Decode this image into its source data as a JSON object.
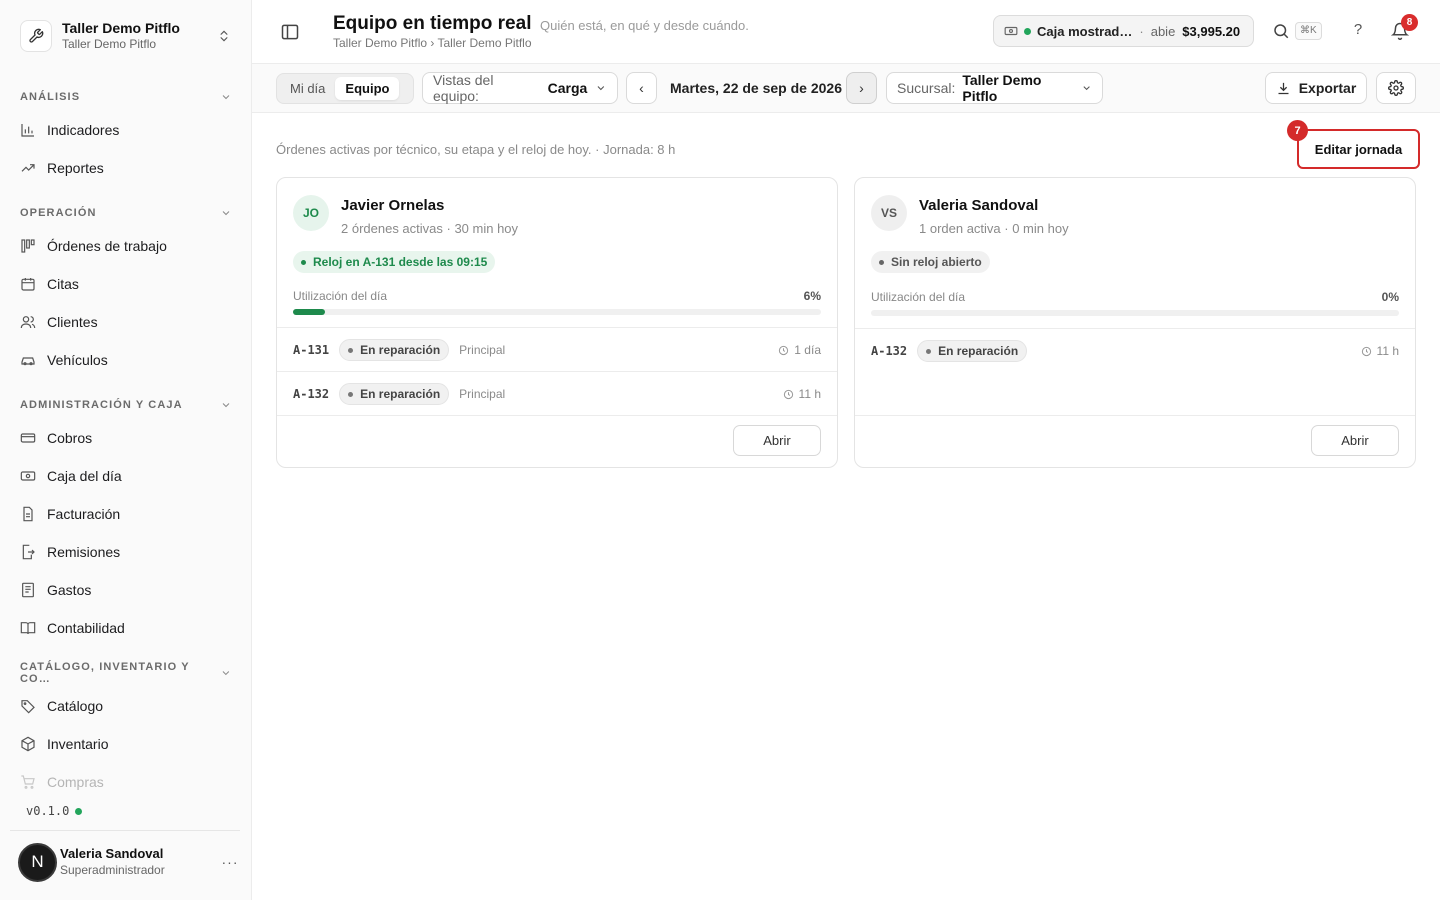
{
  "workspace": {
    "name": "Taller Demo Pitflo",
    "subtitle": "Taller Demo Pitflo"
  },
  "sidebar": {
    "sections": [
      {
        "title": "ANÁLISIS",
        "items": [
          {
            "label": "Indicadores",
            "icon": "bar-chart-icon"
          },
          {
            "label": "Reportes",
            "icon": "trending-up-icon"
          }
        ]
      },
      {
        "title": "OPERACIÓN",
        "items": [
          {
            "label": "Órdenes de trabajo",
            "icon": "kanban-icon"
          },
          {
            "label": "Citas",
            "icon": "calendar-icon"
          },
          {
            "label": "Clientes",
            "icon": "users-icon"
          },
          {
            "label": "Vehículos",
            "icon": "car-icon"
          }
        ]
      },
      {
        "title": "ADMINISTRACIÓN Y CAJA",
        "items": [
          {
            "label": "Cobros",
            "icon": "banknote-icon"
          },
          {
            "label": "Caja del día",
            "icon": "cash-register-icon"
          },
          {
            "label": "Facturación",
            "icon": "file-text-icon"
          },
          {
            "label": "Remisiones",
            "icon": "file-export-icon"
          },
          {
            "label": "Gastos",
            "icon": "receipt-icon"
          },
          {
            "label": "Contabilidad",
            "icon": "book-open-icon"
          }
        ]
      },
      {
        "title": "CATÁLOGO, INVENTARIO Y CO…",
        "items": [
          {
            "label": "Catálogo",
            "icon": "tags-icon"
          },
          {
            "label": "Inventario",
            "icon": "package-icon"
          },
          {
            "label": "Compras",
            "icon": "cart-icon"
          }
        ]
      }
    ],
    "version": "v0.1.0",
    "user": {
      "initial": "N",
      "name": "Valeria Sandoval",
      "role": "Superadministrador",
      "more": "···"
    }
  },
  "header": {
    "title": "Equipo en tiempo real",
    "subtitle": "Quién está, en qué y desde cuándo.",
    "breadcrumb": "Taller Demo Pitflo › Taller Demo Pitflo",
    "cash": {
      "name": "Caja mostrad…",
      "separator": "·",
      "status": "abie",
      "amount": "$3,995.20"
    },
    "shortcut": "⌘K",
    "help": "?",
    "notifications": "8"
  },
  "toolbar": {
    "tabs": [
      {
        "label": "Mi día",
        "active": false
      },
      {
        "label": "Equipo",
        "active": true
      }
    ],
    "view": {
      "label": "Vistas del equipo:",
      "value": "Carga"
    },
    "prev": "‹",
    "date": "Martes, 22 de sep de 2026",
    "next": "›",
    "branch": {
      "label": "Sucursal:",
      "value": "Taller Demo Pitflo"
    },
    "export": "Exportar"
  },
  "main": {
    "description": "Órdenes activas por técnico, su etapa y el reloj de hoy. · Jornada: 8 h",
    "edit_button": "Editar jornada",
    "edit_badge": "7",
    "cards": [
      {
        "initials": "JO",
        "name": "Javier Ornelas",
        "summary": "2 órdenes activas · 30 min hoy",
        "clock": "Reloj en A-131 desde las 09:15",
        "clock_open": true,
        "util_label": "Utilización del día",
        "util_pct": "6%",
        "util_value": 0.06,
        "orders": [
          {
            "id": "A-131",
            "stage": "En reparación",
            "branch": "Principal",
            "elapsed": "1 día"
          },
          {
            "id": "A-132",
            "stage": "En reparación",
            "branch": "Principal",
            "elapsed": "11 h"
          }
        ],
        "open_button": "Abrir"
      },
      {
        "initials": "VS",
        "name": "Valeria Sandoval",
        "summary": "1 orden activa · 0 min hoy",
        "clock": "Sin reloj abierto",
        "clock_open": false,
        "util_label": "Utilización del día",
        "util_pct": "0%",
        "util_value": 0,
        "orders": [
          {
            "id": "A-132",
            "stage": "En reparación",
            "branch": "",
            "elapsed": "11 h"
          }
        ],
        "open_button": "Abrir"
      }
    ]
  },
  "colors": {
    "accent_green": "#1e8a4c",
    "badge_red": "#d92d2d",
    "highlight_red": "#d42a2a"
  }
}
